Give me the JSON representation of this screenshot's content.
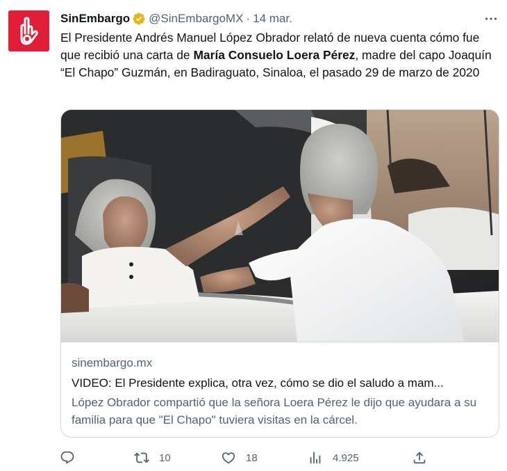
{
  "author": {
    "name": "SinEmbargo",
    "handle": "@SinEmbargoMX",
    "separator": "·",
    "date": "14 mar.",
    "avatar_color": "#e01e37",
    "verified_color": "#e2b719"
  },
  "tweet": {
    "text_before": "El Presidente Andrés Manuel López Obrador relató de nueva cuenta cómo fue que recibió una carta de ",
    "text_bold": "María Consuelo Loera Pérez",
    "text_after": ", madre del capo Joaquín “El Chapo” Guzmán, en Badiraguato, Sinaloa, el pasado 29 de marzo de 2020"
  },
  "card": {
    "domain": "sinembargo.mx",
    "title": "VIDEO: El Presidente explica, otra vez, cómo se dio el saludo a mam...",
    "description": "López Obrador compartió que la señora Loera Pérez le dijo que ayudara a su familia para que \"El Chapo\" tuviera visitas en la cárcel."
  },
  "actions": {
    "reply_icon": "reply-icon",
    "retweet_icon": "retweet-icon",
    "retweet_count": "10",
    "like_icon": "heart-icon",
    "like_count": "18",
    "views_icon": "views-bar-chart-icon",
    "views_count": "4.925",
    "share_icon": "share-icon"
  },
  "colors": {
    "text": "#0f1419",
    "secondary": "#536471",
    "border": "#cfd9de"
  }
}
